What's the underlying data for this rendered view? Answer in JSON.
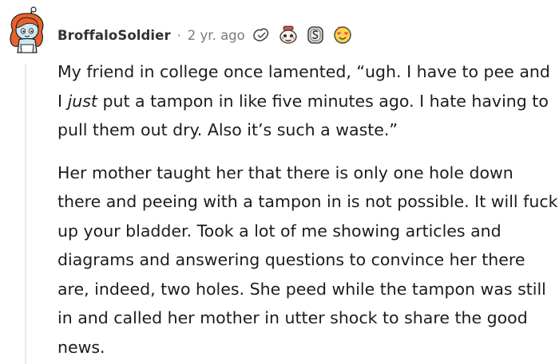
{
  "comment": {
    "author": "BroffaloSoldier",
    "separator": "·",
    "timestamp": "2 yr. ago",
    "awards": [
      "helpful-award-icon",
      "wholesome-seal-icon",
      "silver-award-icon",
      "heart-eyes-award-icon"
    ],
    "paragraph1": {
      "before": "My friend in college once lamented, “ugh. I have to pee and I ",
      "emphasis": "just",
      "after": " put a tampon in like five minutes ago. I hate having to pull them out dry. Also it’s such a waste.”"
    },
    "paragraph2": "Her mother taught her that there is only one hole down there and peeing with a tampon in is not possible. It will fuck up your bladder. Took a lot of me showing articles and diagrams and answering questions to convince her there are, indeed, two holes. She peed while the tampon was still in and called her mother in utter shock to share the good news."
  },
  "colors": {
    "avatar_hair": "#e8632b",
    "avatar_face": "#cfe7f0",
    "muted_text": "#7c7c7c",
    "thread_line": "#e9ebed"
  }
}
